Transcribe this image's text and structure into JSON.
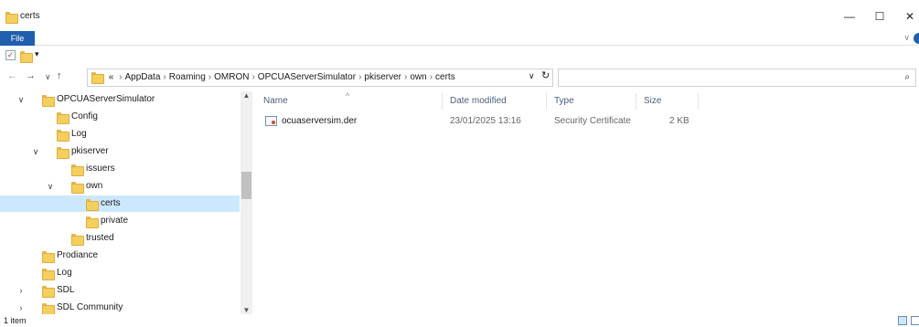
{
  "window": {
    "title": "certs",
    "minimize": "—",
    "maximize": "☐",
    "close": "✕"
  },
  "ribbon": {
    "file_tab": "File",
    "expand": "∨"
  },
  "qat": {
    "check": "✓",
    "dropdown": "▾"
  },
  "nav": {
    "back": "←",
    "forward": "→",
    "recent": "∨",
    "up": "↑"
  },
  "address": {
    "overflow": "«",
    "separator": "›",
    "crumbs": [
      "AppData",
      "Roaming",
      "OMRON",
      "OPCUAServerSimulator",
      "pkiserver",
      "own",
      "certs"
    ],
    "dropdown": "∨",
    "refresh": "↻"
  },
  "search": {
    "placeholder": "",
    "icon": "search-icon",
    "glyph": "⌕"
  },
  "tree": {
    "expanded_glyph": "∨",
    "collapsed_glyph": "›",
    "scroll_up": "▲",
    "scroll_down": "▼",
    "items": [
      {
        "label": "OPCUAServerSimulator",
        "state": "expanded",
        "depth": 0
      },
      {
        "label": "Config",
        "state": "none",
        "depth": 1
      },
      {
        "label": "Log",
        "state": "none",
        "depth": 1
      },
      {
        "label": "pkiserver",
        "state": "expanded",
        "depth": 1
      },
      {
        "label": "issuers",
        "state": "none",
        "depth": 2
      },
      {
        "label": "own",
        "state": "expanded",
        "depth": 2
      },
      {
        "label": "certs",
        "state": "none",
        "depth": 3,
        "selected": true
      },
      {
        "label": "private",
        "state": "none",
        "depth": 3
      },
      {
        "label": "trusted",
        "state": "none",
        "depth": 2
      },
      {
        "label": "Prodiance",
        "state": "none",
        "depth": 0
      },
      {
        "label": "Log",
        "state": "none",
        "depth": 0
      },
      {
        "label": "SDL",
        "state": "collapsed",
        "depth": 0
      },
      {
        "label": "SDL Community",
        "state": "collapsed",
        "depth": 0
      }
    ]
  },
  "list": {
    "sort_arrow": "^",
    "columns": {
      "name": "Name",
      "date_modified": "Date modified",
      "type": "Type",
      "size": "Size"
    },
    "files": [
      {
        "name": "ocuaserversim.der",
        "date_modified": "23/01/2025 13:16",
        "type": "Security Certificate",
        "size": "2 KB"
      }
    ]
  },
  "status": {
    "item_count": "1 item"
  },
  "colors": {
    "accent": "#1f5fae",
    "selection": "#cce8ff",
    "folder": "#f5cf5e"
  }
}
